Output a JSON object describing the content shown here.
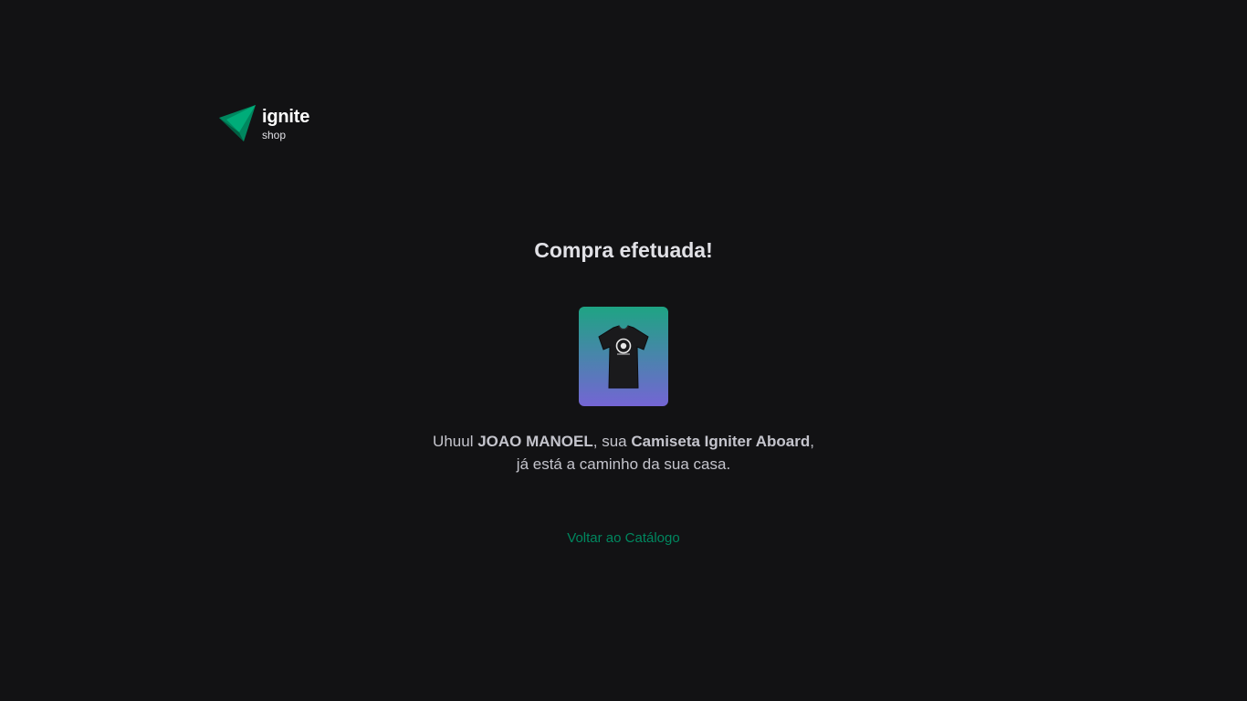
{
  "brand": {
    "name": "ignite",
    "subtitle": "shop",
    "logo_icon": "triangle-logo-icon",
    "colors": {
      "primary": "#00875f",
      "light": "#00b37e"
    }
  },
  "success": {
    "title": "Compra efetuada!",
    "product_image_icon": "tshirt-icon",
    "message": {
      "prefix": "Uhuul ",
      "customer_name": "JOAO MANOEL",
      "middle": ", sua ",
      "product_name": "Camiseta Igniter Aboard",
      "suffix": ",",
      "line2": "já está a caminho da sua casa."
    },
    "back_link_label": "Voltar ao Catálogo"
  },
  "colors": {
    "background": "#121214",
    "text": "#e1e1e6",
    "text_muted": "#c4c4cc",
    "gradient_start": "#1ea483",
    "gradient_end": "#7465d4"
  }
}
